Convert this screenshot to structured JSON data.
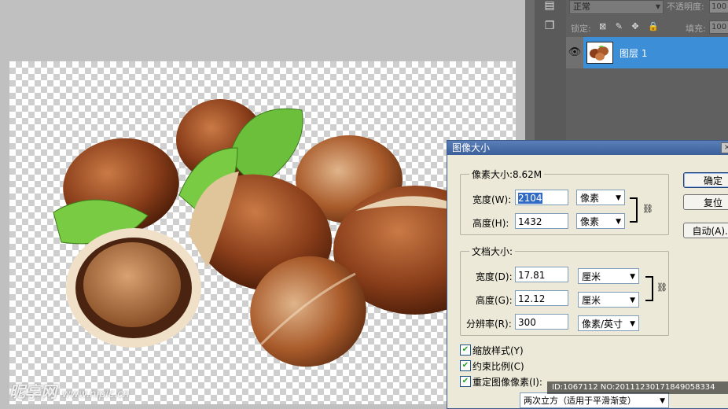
{
  "layers_panel": {
    "blend_mode": "正常",
    "opacity_label": "不透明度:",
    "opacity_value": "100",
    "lock_label": "锁定:",
    "lock_icons": "⊠ ✎ ✥ 🔒",
    "fill_label": "填充:",
    "fill_value": "100",
    "layer_name": "图层 1"
  },
  "dialog": {
    "title": "图像大小",
    "pixel_group_title": "像素大小:8.62M",
    "width_label": "宽度(W):",
    "width_value": "2104",
    "width_unit": "像素",
    "height_label": "高度(H):",
    "height_value": "1432",
    "height_unit": "像素",
    "doc_group_title": "文档大小:",
    "doc_width_label": "宽度(D):",
    "doc_width_value": "17.81",
    "doc_width_unit": "厘米",
    "doc_height_label": "高度(G):",
    "doc_height_value": "12.12",
    "doc_height_unit": "厘米",
    "resolution_label": "分辨率(R):",
    "resolution_value": "300",
    "resolution_unit": "像素/英寸",
    "scale_styles": "缩放样式(Y)",
    "constrain": "约束比例(C)",
    "resample": "重定图像像素(I):",
    "resample_method": "两次立方（适用于平滑渐变）",
    "ok": "确定",
    "reset": "复位",
    "auto": "自动(A)..."
  },
  "watermark": {
    "brand": "昵享网",
    "url": "www.nipic.cn",
    "id": "ID:1067112 NO:20111230171849058334"
  }
}
